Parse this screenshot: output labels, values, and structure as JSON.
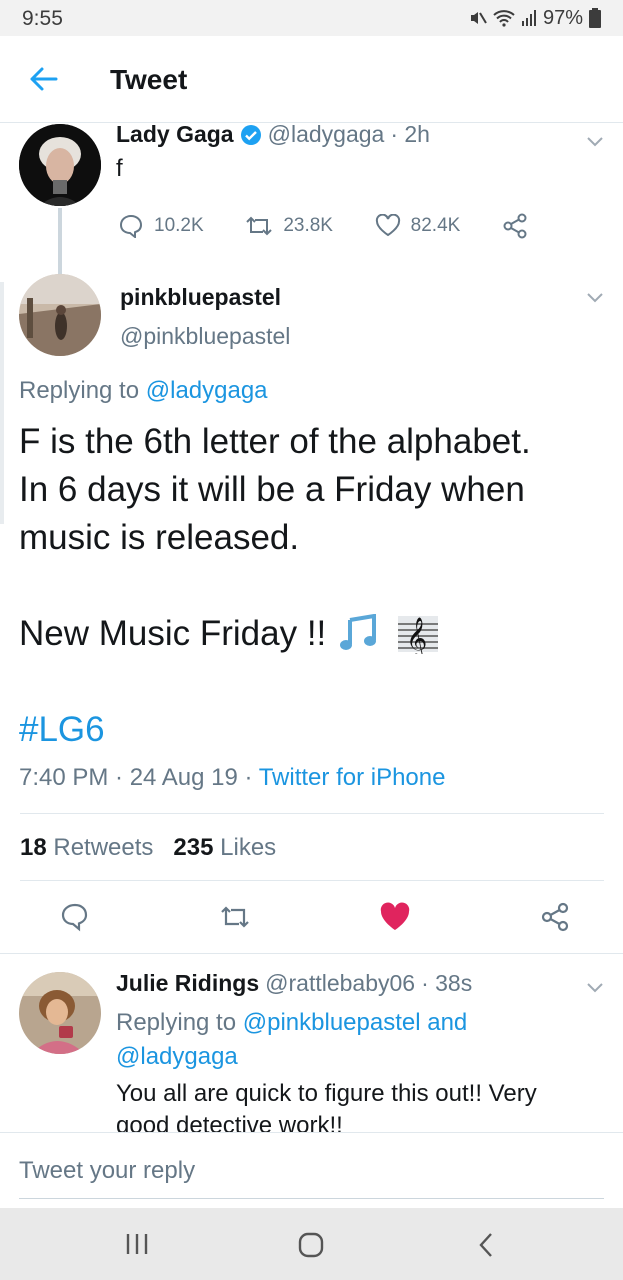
{
  "status_bar": {
    "time": "9:55",
    "battery": "97%"
  },
  "header": {
    "title": "Tweet"
  },
  "tweet1": {
    "name": "Lady Gaga",
    "handle": "@ladygaga",
    "time": "· 2h",
    "text": "f",
    "replies": "10.2K",
    "retweets": "23.8K",
    "likes": "82.4K"
  },
  "main_tweet": {
    "name": "pinkbluepastel",
    "handle": "@pinkbluepastel",
    "replying_prefix": "Replying to",
    "replying_to": "@ladygaga",
    "text_line1": "F is the 6th letter of the alphabet.",
    "text_line2": "In 6 days it will be a Friday when",
    "text_line3": "music is released.",
    "text_line4": "New Music Friday !!",
    "emoji": "🎶 🎼",
    "hashtag": "#LG6",
    "timestamp": "7:40 PM · 24 Aug 19 ·",
    "source": "Twitter for iPhone",
    "retweet_count": "18",
    "retweet_label": "Retweets",
    "like_count": "235",
    "like_label": "Likes"
  },
  "reply_tweet": {
    "name": "Julie Ridings",
    "handle": "@rattlebaby06",
    "time": "· 38s",
    "replying_prefix": "Replying to",
    "replying_to_1": "@pinkbluepastel",
    "replying_and": "and",
    "replying_to_2": "@ladygaga",
    "text_line1": "You all are quick to figure this out!! Very",
    "text_line2": "good detective work!!"
  },
  "reply_input": {
    "placeholder": "Tweet your reply"
  },
  "colors": {
    "accent": "#1da1f2",
    "like": "#e0245e",
    "gray": "#657786"
  }
}
